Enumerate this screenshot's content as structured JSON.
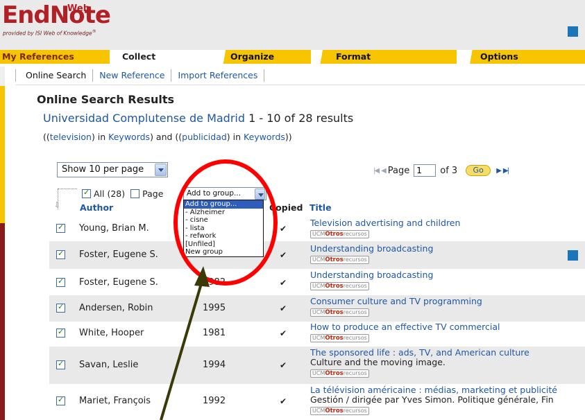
{
  "header": {
    "logo_main": "EndNote",
    "logo_web": "Web",
    "logo_tagline": "provided by ISI Web of Knowledge",
    "logo_tagline_mark": "®"
  },
  "tabs": [
    {
      "label": "My References"
    },
    {
      "label": "Collect"
    },
    {
      "label": "Organize"
    },
    {
      "label": "Format"
    },
    {
      "label": "Options"
    }
  ],
  "subnav": [
    {
      "label": "Online Search"
    },
    {
      "label": "New Reference"
    },
    {
      "label": "Import References"
    }
  ],
  "main": {
    "title": "Online Search Results",
    "source_name": "Universidad Complutense de Madrid",
    "results_range": "1 - 10 of 28 results",
    "query": {
      "open": "((",
      "term1": "television",
      "mid1": ") in ",
      "field1": "Keywords",
      "join": ") and ((",
      "term2": "publicidad",
      "mid2": ") in ",
      "field2": "Keywords",
      "close": "))"
    }
  },
  "per_page": {
    "selected": "Show 10 per page"
  },
  "pager": {
    "page_label": "Page",
    "page_value": "1",
    "of_label": "of 3",
    "go_label": "Go"
  },
  "selection": {
    "all_label": "All (28)",
    "page_label": "Page"
  },
  "group_dropdown": {
    "selected": "Add to group...",
    "options": [
      "Add to group...",
      "- Alzheimer",
      "- cisne",
      "- lista",
      "- refwork",
      "[Unfiled]",
      "New group"
    ]
  },
  "table": {
    "headers": {
      "author": "Author",
      "copied": "Copied",
      "title": "Title"
    },
    "copied_mark": "✔",
    "link_badge": {
      "prefix": "UCM",
      "main": "Otros",
      "sub": "recursos"
    },
    "rows": [
      {
        "author": "Young, Brian M.",
        "year": "",
        "title": "Television advertising and children",
        "sub": ""
      },
      {
        "author": "Foster, Eugene S.",
        "year": "",
        "title": "Understanding broadcasting",
        "sub": ""
      },
      {
        "author": "Foster, Eugene S.",
        "year": "1982",
        "title": "Understanding broadcasting",
        "sub": ""
      },
      {
        "author": "Andersen, Robin",
        "year": "1995",
        "title": "Consumer culture and TV programming",
        "sub": ""
      },
      {
        "author": "White, Hooper",
        "year": "1981",
        "title": "How to produce an effective TV commercial",
        "sub": ""
      },
      {
        "author": "Savan, Leslie",
        "year": "1994",
        "title": "The sponsored life : ads, TV, and American culture",
        "sub": "Culture and the moving image."
      },
      {
        "author": "Mariet, François",
        "year": "1992",
        "title": "La télévision américaine : médias, marketing et publicité",
        "sub": "Gestión / dirigée par Yves Simon. Politique générale, Fin"
      }
    ]
  },
  "colors": {
    "tab_yellow": "#f6c500",
    "link_blue": "#1f57a5",
    "logo_red": "#b12025",
    "annotation_red": "#ff0000",
    "annotation_arrow": "#3a3a08"
  }
}
